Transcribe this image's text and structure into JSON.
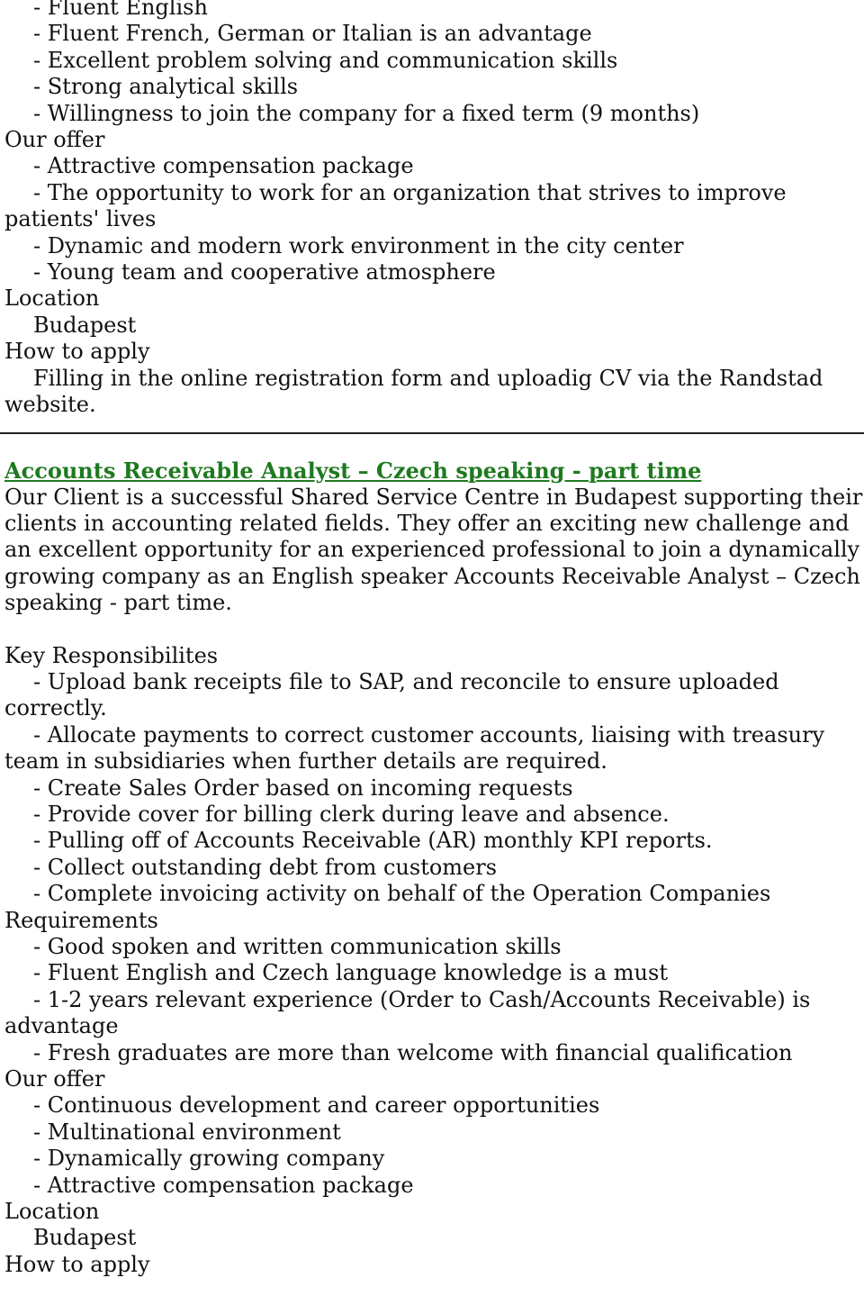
{
  "top_section": {
    "requirements_tail": [
      "- Fluent English",
      "- Fluent French, German or Italian is an advantage",
      "- Excellent problem solving and communication skills",
      "- Strong analytical skills",
      "- Willingness to join the company for a fixed term (9 months)"
    ],
    "offer_heading": "Our offer",
    "offer_items": [
      "- Attractive compensation package",
      "- The opportunity to work for an organization that strives to improve patients' lives",
      "- Dynamic and modern work environment in the city center",
      "- Young team and cooperative atmosphere"
    ],
    "location_heading": "Location",
    "location_value": "Budapest",
    "apply_heading": "How to apply",
    "apply_text": "Filling in the online registration form and uploadig CV via the Randstad website."
  },
  "job": {
    "title": "Accounts Receivable Analyst – Czech speaking - part time",
    "title_color": "#1f7a1f",
    "intro": "Our Client is a successful Shared Service Centre in Budapest supporting their clients in accounting related fields. They offer an exciting new challenge and an excellent opportunity for an experienced professional to join a dynamically growing company as an English speaker Accounts Receivable Analyst – Czech speaking - part time.",
    "responsibilities_heading": "Key Responsibilites",
    "responsibilities": [
      "- Upload bank receipts file to SAP, and reconcile to ensure uploaded correctly.",
      "- Allocate payments to correct customer accounts, liaising with treasury team in subsidiaries when further details are required.",
      "- Create Sales Order based on incoming requests",
      "- Provide cover for billing clerk during leave and absence.",
      "- Pulling off of Accounts Receivable (AR) monthly KPI reports.",
      "- Collect outstanding debt from customers",
      "- Complete invoicing activity on behalf of the Operation Companies"
    ],
    "requirements_heading": "Requirements",
    "requirements": [
      "- Good spoken and written communication skills",
      "- Fluent English and Czech language knowledge is a must",
      "- 1-2 years relevant experience (Order to Cash/Accounts Receivable) is advantage",
      "- Fresh graduates are more than welcome with financial qualification"
    ],
    "offer_heading": "Our offer",
    "offer_items": [
      "- Continuous development and career opportunities",
      "- Multinational environment",
      "- Dynamically growing company",
      "- Attractive compensation package"
    ],
    "location_heading": "Location",
    "location_value": "Budapest",
    "apply_heading": "How to apply"
  }
}
